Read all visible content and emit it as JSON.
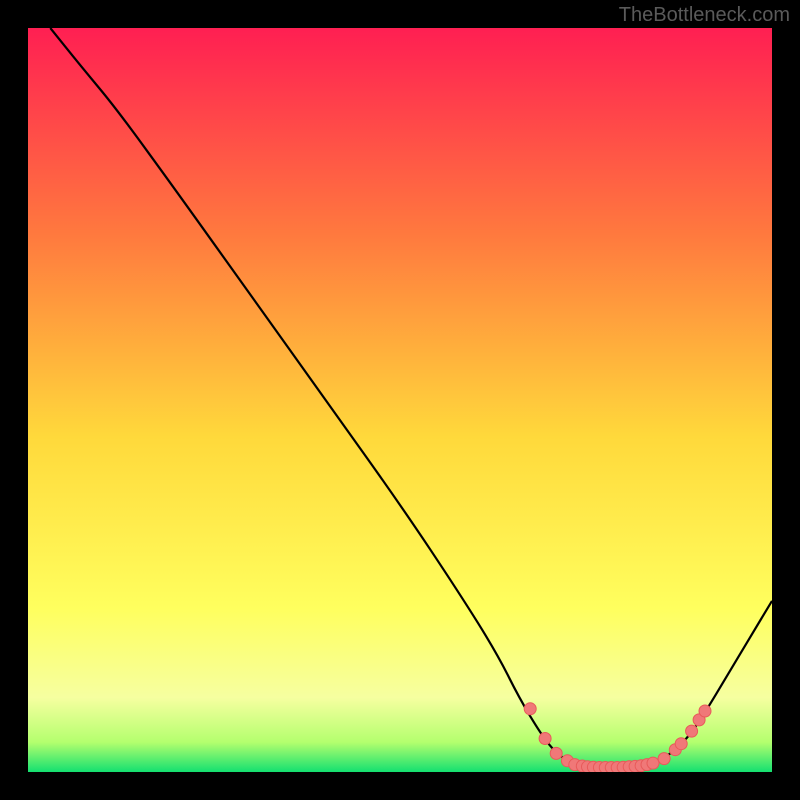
{
  "watermark": "TheBottleneck.com",
  "colors": {
    "bg": "#000000",
    "frame": "#000000",
    "curve": "#000000",
    "marker_fill": "#f07878",
    "marker_stroke": "#e85a5a",
    "grad_top": "#ff1f52",
    "grad_mid1": "#ff7a3e",
    "grad_mid2": "#ffd93b",
    "grad_mid3": "#ffff5e",
    "grad_low": "#f6ffa0",
    "grad_bottom1": "#b4ff6e",
    "grad_bottom2": "#14e070"
  },
  "chart_data": {
    "type": "line",
    "title": "",
    "xlabel": "",
    "ylabel": "",
    "x_range": [
      0,
      100
    ],
    "y_range": [
      0,
      100
    ],
    "curve": [
      {
        "x": 3,
        "y": 100
      },
      {
        "x": 7,
        "y": 95
      },
      {
        "x": 12,
        "y": 89
      },
      {
        "x": 20,
        "y": 78
      },
      {
        "x": 30,
        "y": 64
      },
      {
        "x": 40,
        "y": 50
      },
      {
        "x": 50,
        "y": 36
      },
      {
        "x": 58,
        "y": 24
      },
      {
        "x": 63,
        "y": 16
      },
      {
        "x": 66,
        "y": 10
      },
      {
        "x": 69,
        "y": 5
      },
      {
        "x": 71,
        "y": 2.5
      },
      {
        "x": 73,
        "y": 1.2
      },
      {
        "x": 76,
        "y": 0.6
      },
      {
        "x": 79,
        "y": 0.6
      },
      {
        "x": 82,
        "y": 0.8
      },
      {
        "x": 85,
        "y": 1.5
      },
      {
        "x": 87,
        "y": 3.0
      },
      {
        "x": 89,
        "y": 5.0
      },
      {
        "x": 91,
        "y": 8.0
      },
      {
        "x": 94,
        "y": 13.0
      },
      {
        "x": 97,
        "y": 18.0
      },
      {
        "x": 100,
        "y": 23.0
      }
    ],
    "markers": [
      {
        "x": 67.5,
        "y": 8.5
      },
      {
        "x": 69.5,
        "y": 4.5
      },
      {
        "x": 71.0,
        "y": 2.5
      },
      {
        "x": 72.5,
        "y": 1.5
      },
      {
        "x": 73.5,
        "y": 1.0
      },
      {
        "x": 74.5,
        "y": 0.8
      },
      {
        "x": 75.2,
        "y": 0.7
      },
      {
        "x": 76.0,
        "y": 0.65
      },
      {
        "x": 76.8,
        "y": 0.6
      },
      {
        "x": 77.6,
        "y": 0.6
      },
      {
        "x": 78.4,
        "y": 0.6
      },
      {
        "x": 79.2,
        "y": 0.6
      },
      {
        "x": 80.0,
        "y": 0.65
      },
      {
        "x": 80.8,
        "y": 0.7
      },
      {
        "x": 81.6,
        "y": 0.75
      },
      {
        "x": 82.4,
        "y": 0.85
      },
      {
        "x": 83.2,
        "y": 1.0
      },
      {
        "x": 84.0,
        "y": 1.2
      },
      {
        "x": 85.5,
        "y": 1.8
      },
      {
        "x": 87.0,
        "y": 3.0
      },
      {
        "x": 87.8,
        "y": 3.8
      },
      {
        "x": 89.2,
        "y": 5.5
      },
      {
        "x": 90.2,
        "y": 7.0
      },
      {
        "x": 91.0,
        "y": 8.2
      }
    ]
  }
}
